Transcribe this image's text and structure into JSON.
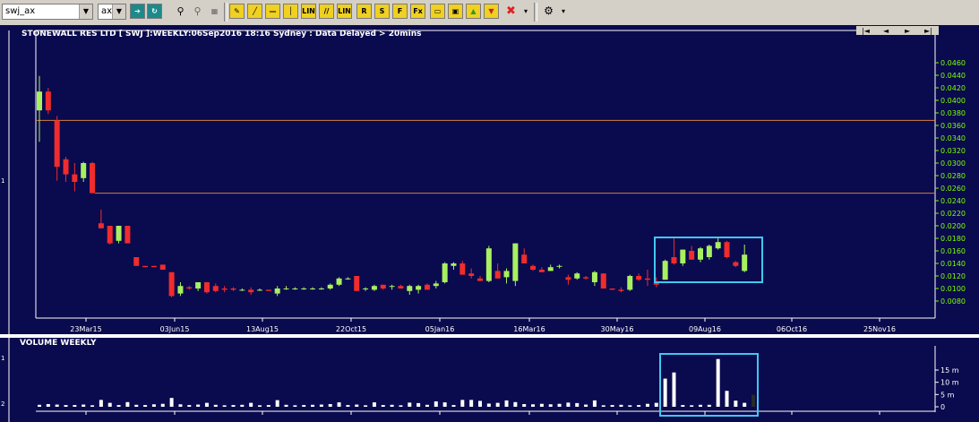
{
  "toolbar": {
    "symbol_value": "swj_ax",
    "exchange_value": "ax",
    "buttons": [
      "LIN",
      "LIN",
      "R",
      "S",
      "F",
      "Fx"
    ]
  },
  "chart": {
    "title": "STONEWALL RES LTD [ SWJ ]:WEEKLY:06Sep2016 18:16 Sydney : Data Delayed > 20mins",
    "nav_labels": [
      "|◄",
      "◄",
      "►",
      "►|"
    ],
    "price_pane_marker": "1",
    "volume_title": "VOLUME WEEKLY",
    "volume_pane_markers": [
      "1",
      "2"
    ],
    "colors": {
      "up": "#a8f060",
      "down": "#f02c2c",
      "background": "#0a0a4e",
      "axis": "#7fff00",
      "hline": "#d08040",
      "highlight": "#40c8f0"
    }
  },
  "chart_data": {
    "type": "candlestick",
    "x_tick_labels": [
      "23Mar15",
      "03Jun15",
      "13Aug15",
      "22Oct15",
      "05Jan16",
      "16Mar16",
      "30May16",
      "09Aug16",
      "06Oct16",
      "25Nov16"
    ],
    "price_tick_labels": [
      "0.0460",
      "0.0440",
      "0.0420",
      "0.0400",
      "0.0380",
      "0.0360",
      "0.0340",
      "0.0320",
      "0.0300",
      "0.0280",
      "0.0260",
      "0.0240",
      "0.0220",
      "0.0200",
      "0.0180",
      "0.0160",
      "0.0140",
      "0.0120",
      "0.0100",
      "0.0080"
    ],
    "ylim": [
      0.007,
      0.047
    ],
    "horizontal_lines": [
      0.0368,
      0.0252
    ],
    "volume_tick_labels": [
      "15 m",
      "10 m",
      "5 m",
      "0"
    ],
    "volume_ylim": [
      0,
      20
    ],
    "candles": [
      {
        "o": 0.0384,
        "h": 0.0439,
        "l": 0.0334,
        "c": 0.0414
      },
      {
        "o": 0.0414,
        "h": 0.042,
        "l": 0.0378,
        "c": 0.0384
      },
      {
        "o": 0.0368,
        "h": 0.0375,
        "l": 0.0272,
        "c": 0.0294
      },
      {
        "o": 0.0306,
        "h": 0.031,
        "l": 0.027,
        "c": 0.0282
      },
      {
        "o": 0.0282,
        "h": 0.03,
        "l": 0.0255,
        "c": 0.027
      },
      {
        "o": 0.0276,
        "h": 0.0302,
        "l": 0.027,
        "c": 0.03
      },
      {
        "o": 0.03,
        "h": 0.0302,
        "l": 0.0252,
        "c": 0.0252
      },
      {
        "o": 0.0204,
        "h": 0.0226,
        "l": 0.0196,
        "c": 0.0196
      },
      {
        "o": 0.02,
        "h": 0.02,
        "l": 0.017,
        "c": 0.0172
      },
      {
        "o": 0.0176,
        "h": 0.02,
        "l": 0.0172,
        "c": 0.02
      },
      {
        "o": 0.02,
        "h": 0.02,
        "l": 0.0172,
        "c": 0.0172
      },
      {
        "o": 0.015,
        "h": 0.015,
        "l": 0.0136,
        "c": 0.0136
      },
      {
        "o": 0.0136,
        "h": 0.0136,
        "l": 0.0134,
        "c": 0.0134
      },
      {
        "o": 0.0136,
        "h": 0.0136,
        "l": 0.0134,
        "c": 0.0134
      },
      {
        "o": 0.0138,
        "h": 0.0138,
        "l": 0.013,
        "c": 0.013
      },
      {
        "o": 0.0126,
        "h": 0.0126,
        "l": 0.0086,
        "c": 0.0088
      },
      {
        "o": 0.0092,
        "h": 0.011,
        "l": 0.0088,
        "c": 0.0104
      },
      {
        "o": 0.0102,
        "h": 0.0104,
        "l": 0.0098,
        "c": 0.01
      },
      {
        "o": 0.01,
        "h": 0.011,
        "l": 0.0096,
        "c": 0.011
      },
      {
        "o": 0.011,
        "h": 0.011,
        "l": 0.0092,
        "c": 0.0094
      },
      {
        "o": 0.0104,
        "h": 0.0108,
        "l": 0.0094,
        "c": 0.0096
      },
      {
        "o": 0.01,
        "h": 0.0104,
        "l": 0.0094,
        "c": 0.0098
      },
      {
        "o": 0.01,
        "h": 0.0102,
        "l": 0.0096,
        "c": 0.0098
      },
      {
        "o": 0.0098,
        "h": 0.01,
        "l": 0.0096,
        "c": 0.0098
      },
      {
        "o": 0.0098,
        "h": 0.0102,
        "l": 0.009,
        "c": 0.0094
      },
      {
        "o": 0.0098,
        "h": 0.01,
        "l": 0.0096,
        "c": 0.0098
      },
      {
        "o": 0.0098,
        "h": 0.0098,
        "l": 0.0096,
        "c": 0.0096
      },
      {
        "o": 0.0092,
        "h": 0.0104,
        "l": 0.0088,
        "c": 0.01
      },
      {
        "o": 0.01,
        "h": 0.0104,
        "l": 0.0098,
        "c": 0.01
      },
      {
        "o": 0.01,
        "h": 0.0102,
        "l": 0.0098,
        "c": 0.01
      },
      {
        "o": 0.01,
        "h": 0.0102,
        "l": 0.0098,
        "c": 0.01
      },
      {
        "o": 0.01,
        "h": 0.0102,
        "l": 0.0098,
        "c": 0.01
      },
      {
        "o": 0.01,
        "h": 0.0102,
        "l": 0.0098,
        "c": 0.01
      },
      {
        "o": 0.01,
        "h": 0.0108,
        "l": 0.0098,
        "c": 0.0106
      },
      {
        "o": 0.0106,
        "h": 0.0118,
        "l": 0.0104,
        "c": 0.0116
      },
      {
        "o": 0.0116,
        "h": 0.0118,
        "l": 0.0114,
        "c": 0.0116
      },
      {
        "o": 0.012,
        "h": 0.012,
        "l": 0.0096,
        "c": 0.0096
      },
      {
        "o": 0.01,
        "h": 0.0102,
        "l": 0.0096,
        "c": 0.01
      },
      {
        "o": 0.0098,
        "h": 0.0106,
        "l": 0.0096,
        "c": 0.0104
      },
      {
        "o": 0.0106,
        "h": 0.0106,
        "l": 0.0098,
        "c": 0.01
      },
      {
        "o": 0.0104,
        "h": 0.0106,
        "l": 0.0098,
        "c": 0.0104
      },
      {
        "o": 0.0104,
        "h": 0.0106,
        "l": 0.01,
        "c": 0.01
      },
      {
        "o": 0.0096,
        "h": 0.0106,
        "l": 0.009,
        "c": 0.0104
      },
      {
        "o": 0.0098,
        "h": 0.0106,
        "l": 0.0092,
        "c": 0.0104
      },
      {
        "o": 0.0106,
        "h": 0.0108,
        "l": 0.0098,
        "c": 0.0098
      },
      {
        "o": 0.0104,
        "h": 0.0112,
        "l": 0.01,
        "c": 0.0108
      },
      {
        "o": 0.011,
        "h": 0.0142,
        "l": 0.0108,
        "c": 0.014
      },
      {
        "o": 0.0136,
        "h": 0.0142,
        "l": 0.013,
        "c": 0.014
      },
      {
        "o": 0.014,
        "h": 0.0144,
        "l": 0.0122,
        "c": 0.0122
      },
      {
        "o": 0.0124,
        "h": 0.0132,
        "l": 0.0116,
        "c": 0.012
      },
      {
        "o": 0.0116,
        "h": 0.012,
        "l": 0.0112,
        "c": 0.0112
      },
      {
        "o": 0.0112,
        "h": 0.0168,
        "l": 0.011,
        "c": 0.0164
      },
      {
        "o": 0.0128,
        "h": 0.014,
        "l": 0.0116,
        "c": 0.0116
      },
      {
        "o": 0.0118,
        "h": 0.0132,
        "l": 0.0108,
        "c": 0.0128
      },
      {
        "o": 0.0112,
        "h": 0.0172,
        "l": 0.0104,
        "c": 0.0172
      },
      {
        "o": 0.0154,
        "h": 0.0164,
        "l": 0.014,
        "c": 0.014
      },
      {
        "o": 0.0136,
        "h": 0.0138,
        "l": 0.0128,
        "c": 0.013
      },
      {
        "o": 0.013,
        "h": 0.0134,
        "l": 0.0126,
        "c": 0.0126
      },
      {
        "o": 0.0128,
        "h": 0.0138,
        "l": 0.0128,
        "c": 0.0134
      },
      {
        "o": 0.0136,
        "h": 0.0138,
        "l": 0.0132,
        "c": 0.0136
      },
      {
        "o": 0.0118,
        "h": 0.0122,
        "l": 0.0106,
        "c": 0.0114
      },
      {
        "o": 0.0116,
        "h": 0.0126,
        "l": 0.0114,
        "c": 0.0124
      },
      {
        "o": 0.0118,
        "h": 0.012,
        "l": 0.0114,
        "c": 0.0116
      },
      {
        "o": 0.011,
        "h": 0.0128,
        "l": 0.0104,
        "c": 0.0126
      },
      {
        "o": 0.0124,
        "h": 0.0124,
        "l": 0.01,
        "c": 0.01
      },
      {
        "o": 0.01,
        "h": 0.01,
        "l": 0.0098,
        "c": 0.0098
      },
      {
        "o": 0.0098,
        "h": 0.0102,
        "l": 0.0094,
        "c": 0.0096
      },
      {
        "o": 0.0098,
        "h": 0.0122,
        "l": 0.0096,
        "c": 0.012
      },
      {
        "o": 0.012,
        "h": 0.0124,
        "l": 0.0112,
        "c": 0.0114
      },
      {
        "o": 0.0116,
        "h": 0.013,
        "l": 0.0104,
        "c": 0.0114
      },
      {
        "o": 0.011,
        "h": 0.0118,
        "l": 0.0102,
        "c": 0.0106
      },
      {
        "o": 0.0114,
        "h": 0.0146,
        "l": 0.0114,
        "c": 0.0144
      },
      {
        "o": 0.015,
        "h": 0.018,
        "l": 0.0138,
        "c": 0.014
      },
      {
        "o": 0.014,
        "h": 0.0162,
        "l": 0.0136,
        "c": 0.0162
      },
      {
        "o": 0.016,
        "h": 0.0168,
        "l": 0.0146,
        "c": 0.0146
      },
      {
        "o": 0.0146,
        "h": 0.0166,
        "l": 0.0142,
        "c": 0.0164
      },
      {
        "o": 0.015,
        "h": 0.017,
        "l": 0.0146,
        "c": 0.0168
      },
      {
        "o": 0.0164,
        "h": 0.018,
        "l": 0.0162,
        "c": 0.0174
      },
      {
        "o": 0.0174,
        "h": 0.0176,
        "l": 0.0148,
        "c": 0.015
      },
      {
        "o": 0.0142,
        "h": 0.0144,
        "l": 0.0134,
        "c": 0.0136
      },
      {
        "o": 0.0128,
        "h": 0.017,
        "l": 0.0126,
        "c": 0.0154
      }
    ],
    "volume": [
      0.8,
      1.1,
      0.9,
      0.7,
      0.7,
      0.9,
      0.6,
      2.8,
      1.6,
      0.7,
      1.9,
      0.8,
      0.7,
      1.0,
      1.2,
      3.6,
      1.0,
      0.7,
      0.9,
      1.6,
      0.8,
      0.6,
      0.7,
      0.8,
      1.6,
      0.6,
      0.7,
      2.7,
      0.8,
      0.6,
      0.7,
      0.8,
      0.9,
      1.1,
      1.8,
      0.7,
      0.9,
      0.6,
      1.8,
      0.7,
      0.8,
      0.6,
      1.7,
      1.5,
      0.8,
      2.2,
      1.8,
      0.7,
      2.8,
      2.8,
      2.4,
      1.3,
      1.6,
      2.6,
      1.9,
      1.1,
      1.0,
      1.2,
      1.0,
      1.2,
      1.7,
      1.5,
      0.9,
      2.6,
      0.6,
      0.7,
      0.8,
      0.6,
      0.7,
      1.2,
      1.6,
      11.5,
      14.0,
      0.7,
      0.6,
      0.8,
      0.8,
      19.5,
      6.5,
      2.5,
      1.6,
      4.9
    ]
  }
}
